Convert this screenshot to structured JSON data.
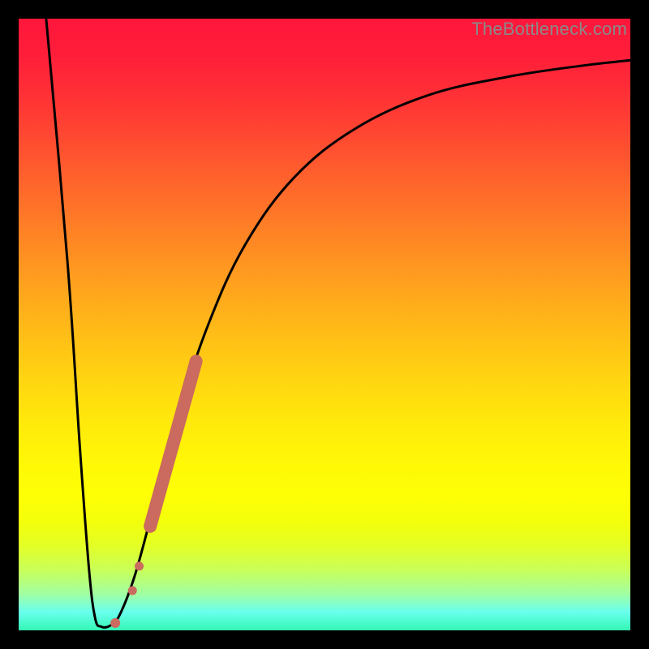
{
  "watermark": "TheBottleneck.com",
  "chart_data": {
    "type": "line",
    "title": "",
    "xlabel": "",
    "ylabel": "",
    "xlim": [
      0,
      100
    ],
    "ylim": [
      0,
      100
    ],
    "grid": false,
    "series": [
      {
        "name": "curve",
        "stroke": "#000000",
        "stroke_width": 3,
        "points": [
          {
            "x": 4.5,
            "y": 100
          },
          {
            "x": 8.0,
            "y": 60
          },
          {
            "x": 10.0,
            "y": 30
          },
          {
            "x": 11.5,
            "y": 10
          },
          {
            "x": 12.5,
            "y": 2
          },
          {
            "x": 13.5,
            "y": 0.6
          },
          {
            "x": 15.0,
            "y": 0.8
          },
          {
            "x": 16.5,
            "y": 2.5
          },
          {
            "x": 19.0,
            "y": 9
          },
          {
            "x": 22.0,
            "y": 20
          },
          {
            "x": 26.0,
            "y": 35
          },
          {
            "x": 31.0,
            "y": 50
          },
          {
            "x": 37.0,
            "y": 63
          },
          {
            "x": 45.0,
            "y": 74
          },
          {
            "x": 55.0,
            "y": 82
          },
          {
            "x": 67.0,
            "y": 87.5
          },
          {
            "x": 80.0,
            "y": 90.5
          },
          {
            "x": 92.0,
            "y": 92.3
          },
          {
            "x": 100.0,
            "y": 93.2
          }
        ]
      }
    ],
    "markers": [
      {
        "name": "dot-bottom",
        "x": 15.8,
        "y": 1.2,
        "r": 6,
        "fill": "#cb6a5e"
      },
      {
        "name": "dot-mid1",
        "x": 18.6,
        "y": 6.5,
        "r": 5.5,
        "fill": "#cb6a5e"
      },
      {
        "name": "dot-mid2",
        "x": 19.7,
        "y": 10.5,
        "r": 5.5,
        "fill": "#cb6a5e"
      }
    ],
    "bars": [
      {
        "name": "thick-segment",
        "x1": 21.5,
        "y1": 17,
        "x2": 29.0,
        "y2": 44,
        "width": 16,
        "fill": "#cb6a5e"
      }
    ],
    "gradient_stops": [
      {
        "pos": 0,
        "color": "#ff163b"
      },
      {
        "pos": 50,
        "color": "#ffb800"
      },
      {
        "pos": 80,
        "color": "#faff05"
      },
      {
        "pos": 100,
        "color": "#33f7b3"
      }
    ]
  }
}
